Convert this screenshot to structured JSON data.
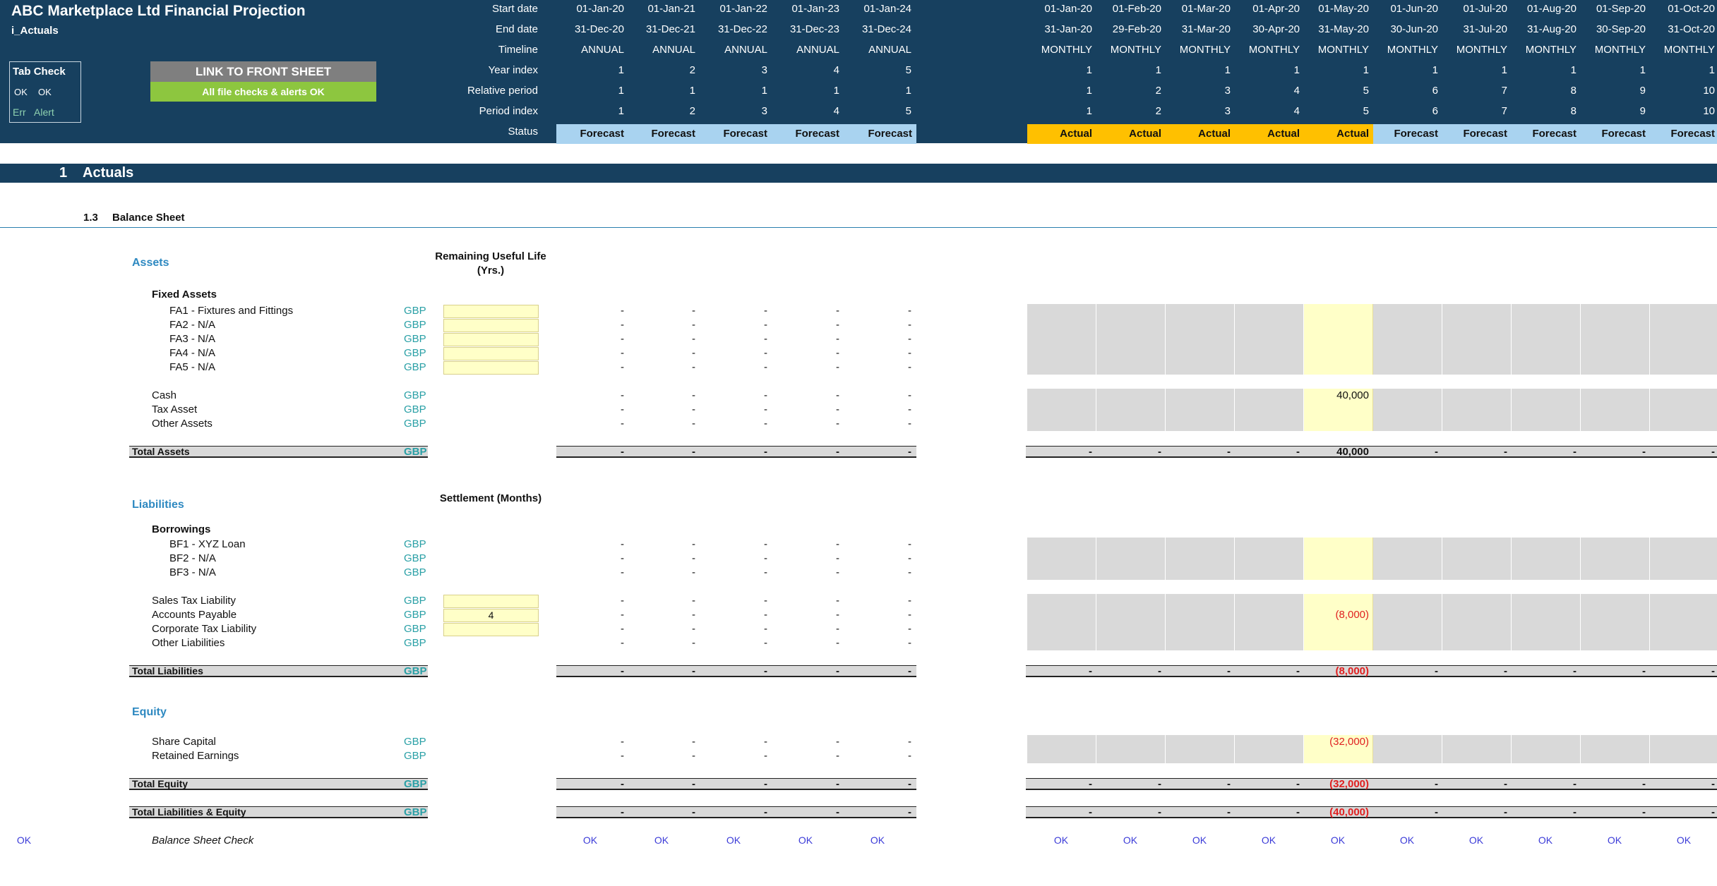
{
  "header": {
    "title": "ABC Marketplace Ltd Financial Projection",
    "sheet_name": "i_Actuals",
    "tab_check": {
      "title": "Tab Check",
      "ok1": "OK",
      "ok2": "OK",
      "err": "Err",
      "alert": "Alert"
    },
    "link_button": "LINK TO FRONT SHEET",
    "checks_status": "All file checks & alerts OK",
    "row_labels": [
      "Start date",
      "End date",
      "Timeline",
      "Year index",
      "Relative period",
      "Period index",
      "Status"
    ],
    "annual": {
      "start": [
        "01-Jan-20",
        "01-Jan-21",
        "01-Jan-22",
        "01-Jan-23",
        "01-Jan-24"
      ],
      "end": [
        "31-Dec-20",
        "31-Dec-21",
        "31-Dec-22",
        "31-Dec-23",
        "31-Dec-24"
      ],
      "timeline": [
        "ANNUAL",
        "ANNUAL",
        "ANNUAL",
        "ANNUAL",
        "ANNUAL"
      ],
      "year_index": [
        "1",
        "2",
        "3",
        "4",
        "5"
      ],
      "relative": [
        "1",
        "1",
        "1",
        "1",
        "1"
      ],
      "period_index": [
        "1",
        "2",
        "3",
        "4",
        "5"
      ],
      "status": [
        "Forecast",
        "Forecast",
        "Forecast",
        "Forecast",
        "Forecast"
      ]
    },
    "monthly": {
      "start": [
        "01-Jan-20",
        "01-Feb-20",
        "01-Mar-20",
        "01-Apr-20",
        "01-May-20",
        "01-Jun-20",
        "01-Jul-20",
        "01-Aug-20",
        "01-Sep-20",
        "01-Oct-20"
      ],
      "end": [
        "31-Jan-20",
        "29-Feb-20",
        "31-Mar-20",
        "30-Apr-20",
        "31-May-20",
        "30-Jun-20",
        "31-Jul-20",
        "31-Aug-20",
        "30-Sep-20",
        "31-Oct-20"
      ],
      "timeline": [
        "MONTHLY",
        "MONTHLY",
        "MONTHLY",
        "MONTHLY",
        "MONTHLY",
        "MONTHLY",
        "MONTHLY",
        "MONTHLY",
        "MONTHLY",
        "MONTHLY"
      ],
      "year_index": [
        "1",
        "1",
        "1",
        "1",
        "1",
        "1",
        "1",
        "1",
        "1",
        "1"
      ],
      "relative": [
        "1",
        "2",
        "3",
        "4",
        "5",
        "6",
        "7",
        "8",
        "9",
        "10"
      ],
      "period_index": [
        "1",
        "2",
        "3",
        "4",
        "5",
        "6",
        "7",
        "8",
        "9",
        "10"
      ],
      "status": [
        "Actual",
        "Actual",
        "Actual",
        "Actual",
        "Actual",
        "Forecast",
        "Forecast",
        "Forecast",
        "Forecast",
        "Forecast"
      ]
    }
  },
  "colors": {
    "navy": "#17405f",
    "actual": "#ffc000",
    "forecast": "#a9d3f0",
    "input_yellow": "#ffffc8",
    "cell_grey": "#d9d9d9",
    "category_blue": "#2e89c1",
    "unit_teal": "#2aa0a6",
    "negative_red": "#e02020",
    "check_blue": "#3b3bd8"
  },
  "section": {
    "number": "1",
    "title": "Actuals"
  },
  "subsection": {
    "number": "1.3",
    "title": "Balance Sheet"
  },
  "assets": {
    "heading": "Assets",
    "column_header": "Remaining Useful Life (Yrs.)",
    "fixed_assets_heading": "Fixed Assets",
    "fixed_assets": [
      "FA1 - Fixtures and Fittings",
      "FA2 - N/A",
      "FA3 - N/A",
      "FA4 - N/A",
      "FA5 - N/A"
    ],
    "other": [
      "Cash",
      "Tax Asset",
      "Other Assets"
    ],
    "cash_may": "40,000",
    "total_label": "Total Assets",
    "total_may": "40,000"
  },
  "liabilities": {
    "heading": "Liabilities",
    "column_header": "Settlement (Months)",
    "borrowings_heading": "Borrowings",
    "borrowings": [
      "BF1 - XYZ Loan",
      "BF2 - N/A",
      "BF3 - N/A"
    ],
    "other": [
      "Sales Tax Liability",
      "Accounts Payable",
      "Corporate Tax Liability",
      "Other Liabilities"
    ],
    "accounts_payable_settlement": "4",
    "accounts_payable_may": "(8,000)",
    "total_label": "Total Liabilities",
    "total_may": "(8,000)"
  },
  "equity": {
    "heading": "Equity",
    "items": [
      "Share Capital",
      "Retained Earnings"
    ],
    "share_capital_may": "(32,000)",
    "total_label": "Total Equity",
    "total_may": "(32,000)"
  },
  "total_le": {
    "label": "Total Liabilities & Equity",
    "may": "(40,000)"
  },
  "check": {
    "label": "Balance Sheet Check",
    "value": "OK"
  },
  "unit": "GBP",
  "dash": "-"
}
